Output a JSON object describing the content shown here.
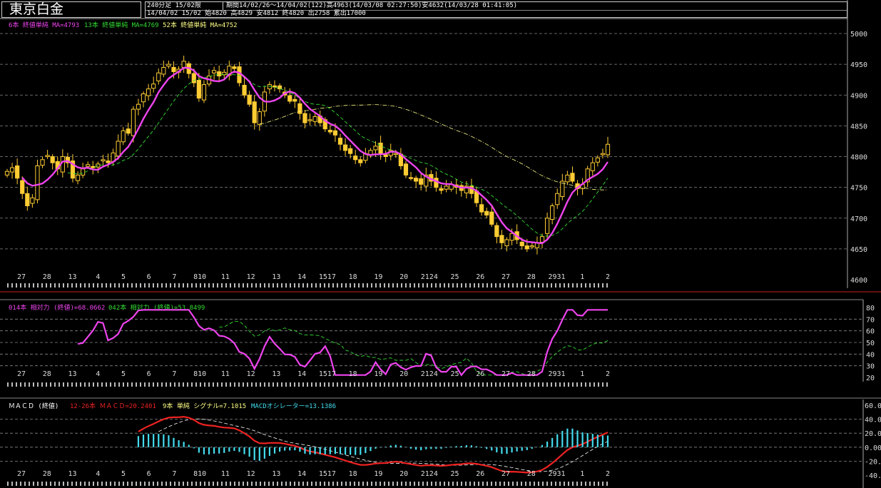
{
  "header": {
    "title": "東京白金",
    "period_label": "240分足 15/02限",
    "info_line1": "期間14/02/26～14/04/02(122)高4963(14/03/08 02:27:50)安4632(14/03/28 01:41:05)",
    "info_line2": "14/04/02 15/02 始4820 高4829 安4812 終4820 出2758 累出17000"
  },
  "price_legend": {
    "ma6": "6本 終値単純 MA=4793",
    "ma13": "13本 終値単純 MA=4769",
    "ma52": "52本 終値単純 MA=4752"
  },
  "rsi_legend": {
    "rsi14": "014本 相対力 (終値)=68.0662",
    "rsi42": "042本 相対力 (終値)=53.8499"
  },
  "macd_legend": {
    "label": "ＭＡＣＤ (終値)",
    "macd": "12-26本 ＭＡＣＤ=20.2401",
    "signal": "9本 単純 シグナル=7.1015",
    "osc": "MACDオシレーター=13.1386"
  },
  "day_labels": [
    "27",
    "28",
    "13",
    "4",
    "5",
    "6",
    "7",
    "810",
    "11",
    "12",
    "13",
    "14",
    "1517",
    "18",
    "19",
    "20",
    "2124",
    "25",
    "26",
    "27",
    "28",
    "2931",
    "1",
    "2"
  ],
  "colors": {
    "up": "#ffcc33",
    "ma6": "#ee44ee",
    "ma13": "#33dd33",
    "ma52": "#ffff88",
    "macd": "#ee2222",
    "signal": "#ffffff",
    "osc": "#44ddee",
    "grid": "#888888"
  },
  "chart_data": [
    {
      "type": "candlestick",
      "ylim": [
        4600,
        5000
      ],
      "y_ticks": [
        "4600",
        "4650",
        "4700",
        "4750",
        "4800",
        "4850",
        "4900",
        "4950",
        "5000"
      ],
      "close": [
        4776,
        4782,
        4765,
        4740,
        4720,
        4733,
        4785,
        4795,
        4802,
        4790,
        4780,
        4800,
        4790,
        4765,
        4770,
        4780,
        4787,
        4782,
        4788,
        4795,
        4790,
        4806,
        4825,
        4842,
        4838,
        4877,
        4885,
        4902,
        4910,
        4918,
        4936,
        4945,
        4950,
        4938,
        4942,
        4955,
        4935,
        4920,
        4895,
        4917,
        4931,
        4940,
        4931,
        4937,
        4947,
        4943,
        4920,
        4900,
        4885,
        4855,
        4873,
        4905,
        4917,
        4913,
        4910,
        4900,
        4890,
        4890,
        4870,
        4855,
        4860,
        4865,
        4855,
        4845,
        4840,
        4835,
        4820,
        4810,
        4805,
        4795,
        4790,
        4805,
        4810,
        4817,
        4805,
        4800,
        4810,
        4805,
        4785,
        4770,
        4765,
        4760,
        4755,
        4770,
        4760,
        4750,
        4745,
        4752,
        4755,
        4750,
        4745,
        4752,
        4740,
        4725,
        4710,
        4705,
        4690,
        4670,
        4660,
        4665,
        4675,
        4665,
        4655,
        4650,
        4655,
        4660,
        4670,
        4700,
        4720,
        4740,
        4760,
        4770,
        4760,
        4748,
        4755,
        4780,
        4790,
        4798,
        4805,
        4820
      ],
      "ma6_end": 4793,
      "ma13_end": 4769,
      "ma52_end": 4752
    },
    {
      "type": "line",
      "ylim": [
        20,
        80
      ],
      "y_ticks": [
        "20",
        "30",
        "40",
        "50",
        "60",
        "70",
        "80"
      ],
      "series": [
        {
          "name": "014本 相対力 (終値)"
        },
        {
          "name": "042本 相対力 (終値)"
        }
      ],
      "rsi14_end": 68.0662,
      "rsi42_end": 53.8499
    },
    {
      "type": "line",
      "ylim": [
        -40,
        60
      ],
      "y_ticks": [
        "60.0000",
        "40.0000",
        "20.0000",
        "0.0000",
        "-20.0000",
        "-40.0000"
      ],
      "series": [
        {
          "name": "12-26本 ＭＡＣＤ"
        },
        {
          "name": "9本 単純 シグナル"
        },
        {
          "name": "MACDオシレーター"
        }
      ],
      "macd_end": 20.2401,
      "signal_end": 7.1015,
      "osc_end": 13.1386
    }
  ]
}
